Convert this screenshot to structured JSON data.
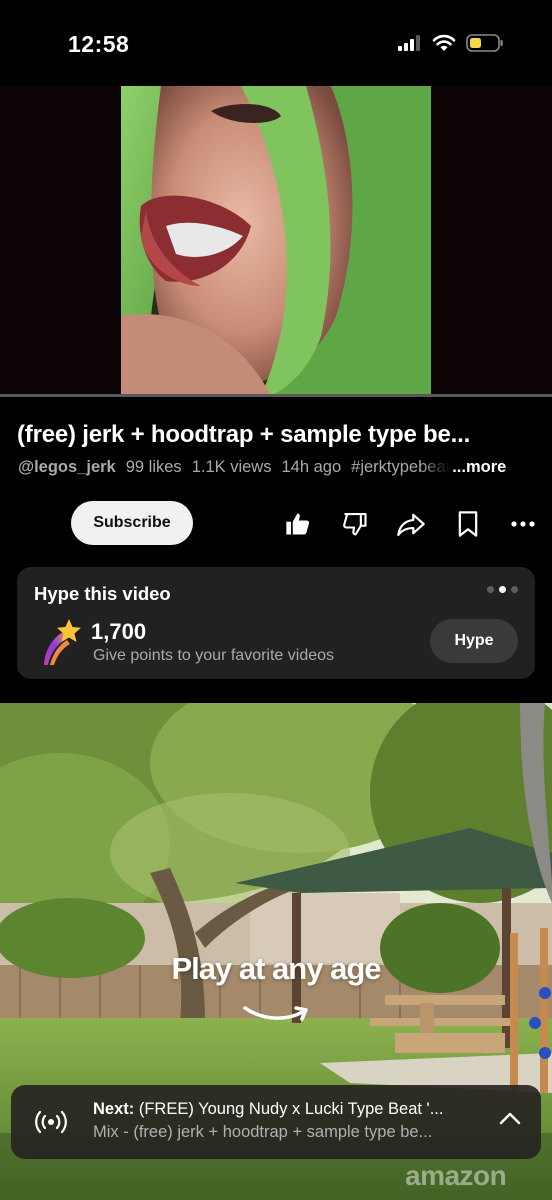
{
  "status": {
    "time": "12:58",
    "battery_color": "#f7d648"
  },
  "player": {
    "progress_fraction": 0.0
  },
  "video": {
    "title": "(free) jerk + hoodtrap + sample type be...",
    "channel": "@legos_jerk",
    "likes": "99 likes",
    "views": "1.1K views",
    "age": "14h ago",
    "hashtag": "#jerktypebeat",
    "more_label": "...more"
  },
  "actions": {
    "subscribe_label": "Subscribe",
    "icons": [
      "thumbs-up-icon",
      "thumbs-down-icon",
      "share-icon",
      "save-icon",
      "more-icon"
    ]
  },
  "hype": {
    "title": "Hype this video",
    "points": "1,700",
    "subtitle": "Give points to your favorite videos",
    "button_label": "Hype",
    "page_indicator": {
      "count": 3,
      "active": 1
    }
  },
  "ad": {
    "tagline": "Play at any age",
    "brand": "amazon"
  },
  "next_bar": {
    "prefix": "Next:",
    "title": "(FREE) Young Nudy x Lucki Type Beat '...",
    "subtitle": "Mix - (free) jerk + hoodtrap + sample type be..."
  },
  "colors": {
    "accent_white": "#f1f1f1",
    "card_bg": "#212121",
    "secondary_text": "#aaaaaa"
  }
}
